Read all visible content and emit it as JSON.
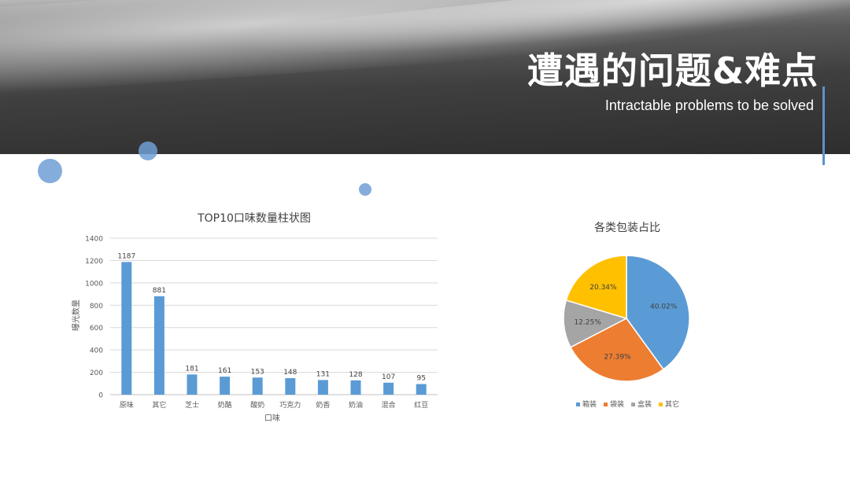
{
  "slide": {
    "title": "遭遇的问题&难点",
    "subtitle": "Intractable problems to be solved"
  },
  "colors": {
    "accent": "#5b93c9",
    "bar": "#5b9bd5"
  },
  "chart_data": [
    {
      "type": "bar",
      "title": "TOP10口味数量柱状图",
      "xlabel": "口味",
      "ylabel": "曝光数量",
      "ylim": [
        0,
        1400
      ],
      "yticks": [
        0,
        200,
        400,
        600,
        800,
        1000,
        1200,
        1400
      ],
      "grid": true,
      "categories": [
        "原味",
        "其它",
        "芝士",
        "奶酪",
        "酸奶",
        "巧克力",
        "奶香",
        "奶油",
        "混合",
        "红豆"
      ],
      "values": [
        1187,
        881,
        181,
        161,
        153,
        148,
        131,
        128,
        107,
        95
      ],
      "bar_color": "#5b9bd5"
    },
    {
      "type": "pie",
      "title": "各类包装占比",
      "legend_position": "bottom",
      "slices": [
        {
          "label": "箱装",
          "value": 40.02,
          "display": "40.02%",
          "color": "#5b9bd5"
        },
        {
          "label": "袋装",
          "value": 27.39,
          "display": "27.39%",
          "color": "#ed7d31"
        },
        {
          "label": "盒装",
          "value": 12.25,
          "display": "12.25%",
          "color": "#a5a5a5"
        },
        {
          "label": "其它",
          "value": 20.34,
          "display": "20.34%",
          "color": "#ffc000"
        }
      ]
    }
  ]
}
